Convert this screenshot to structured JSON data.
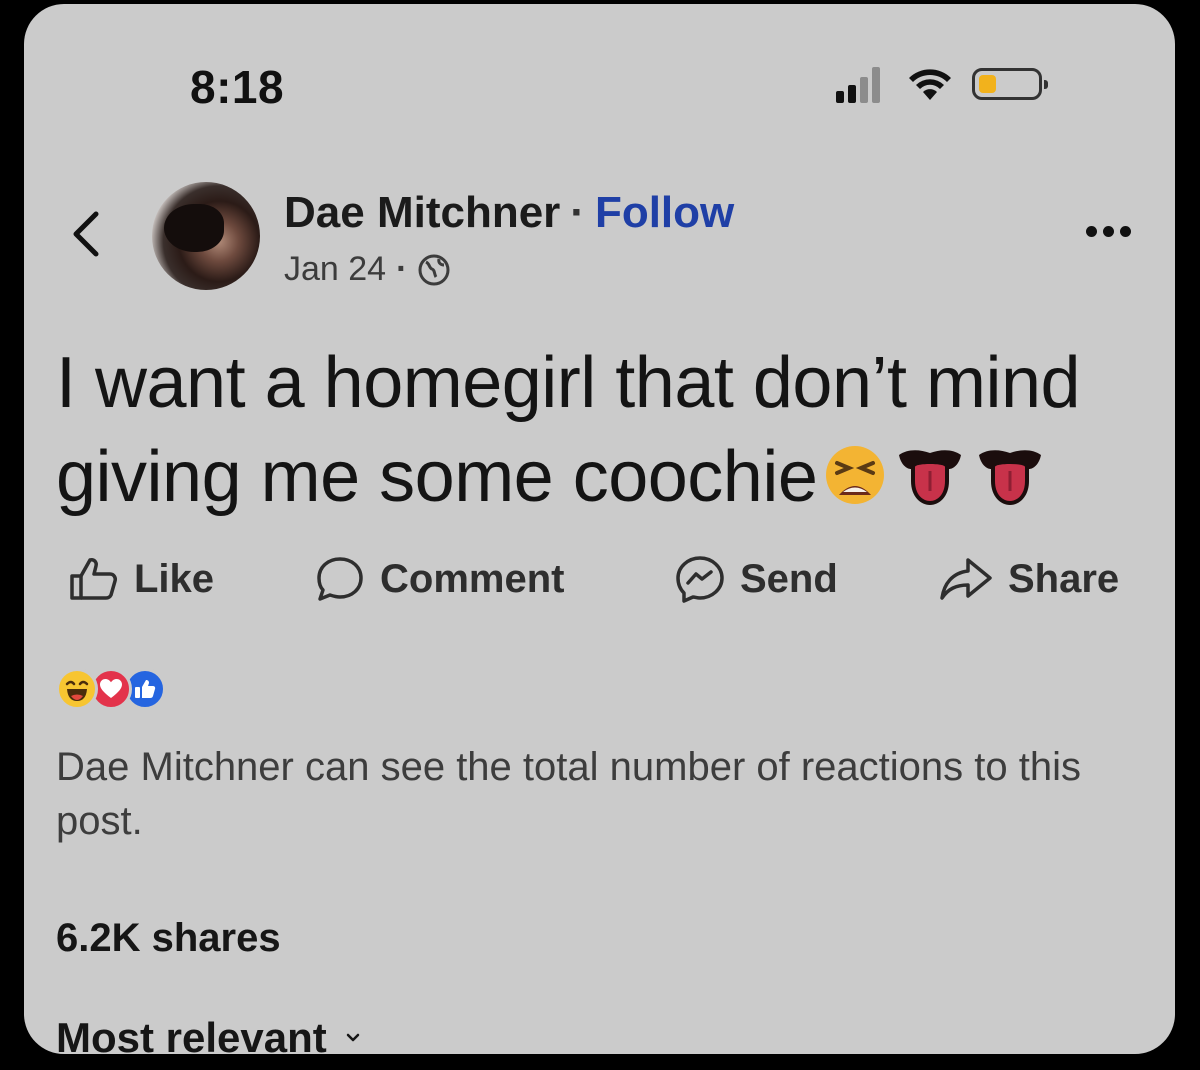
{
  "status_bar": {
    "time": "8:18",
    "signal_icon": "cellular-signal-icon",
    "wifi_icon": "wifi-icon",
    "battery_icon": "battery-icon",
    "battery_level": 0.3,
    "battery_color": "#f2b21c"
  },
  "header": {
    "back_icon": "chevron-left-icon",
    "author_name": "Dae Mitchner",
    "separator": "·",
    "follow_label": "Follow",
    "date": "Jan 24",
    "meta_separator": "·",
    "audience_icon": "globe-icon",
    "more_icon": "more-horizontal-icon"
  },
  "post": {
    "text_line1": "I want a homegirl that don’t mind",
    "text_line2": "giving me some coochie",
    "emojis": [
      "tired-face-emoji",
      "tongue-emoji",
      "tongue-emoji"
    ]
  },
  "actions": {
    "like_label": "Like",
    "comment_label": "Comment",
    "send_label": "Send",
    "share_label": "Share",
    "like_icon": "thumbs-up-icon",
    "comment_icon": "comment-bubble-icon",
    "send_icon": "messenger-icon",
    "share_icon": "share-arrow-icon"
  },
  "reactions": {
    "types": [
      "haha",
      "love",
      "like"
    ],
    "notice": "Dae Mitchner can see the total number of reactions to this post."
  },
  "stats": {
    "shares": "6.2K shares"
  },
  "comments": {
    "sort_label": "Most relevant",
    "sort_icon": "chevron-down-icon"
  },
  "colors": {
    "background": "#cbcbcb",
    "follow_link": "#1f3fa6",
    "haha": "#f7c531",
    "love": "#e3334b",
    "like": "#2565e0"
  }
}
